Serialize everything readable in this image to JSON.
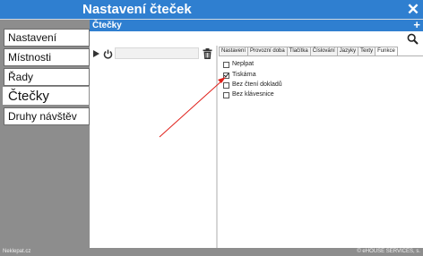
{
  "window": {
    "title": "Nastavení čteček",
    "close_icon": "close-icon"
  },
  "subheader": {
    "title": "Čtečky",
    "add_icon": "plus-icon"
  },
  "nav": {
    "items": [
      {
        "label": "Nastavení"
      },
      {
        "label": "Místnosti"
      },
      {
        "label": "Řady"
      },
      {
        "label": "Čtečky",
        "active": true
      },
      {
        "label": "Druhy návštěv"
      }
    ]
  },
  "toolbar": {
    "play_icon": "play-icon",
    "power_icon": "power-icon",
    "input_value": "",
    "trash_icon": "trash-icon",
    "search_icon": "search-icon"
  },
  "tabs": [
    "Nastavení",
    "Provozní doba",
    "Tlačítka",
    "Číslování",
    "Jazyky",
    "Texty",
    "Funkce"
  ],
  "active_tab": "Funkce",
  "options": [
    {
      "label": "Neplpat",
      "checked": false
    },
    {
      "label": "Tiskárna",
      "checked": true
    },
    {
      "label": "Bez čtení dokladů",
      "checked": false
    },
    {
      "label": "Bez klávesnice",
      "checked": false
    }
  ],
  "annotation": {
    "color": "#e0201a"
  },
  "footer": {
    "left": "Neklepat.cz",
    "right": "© eHOUSE SERVICES, s."
  }
}
